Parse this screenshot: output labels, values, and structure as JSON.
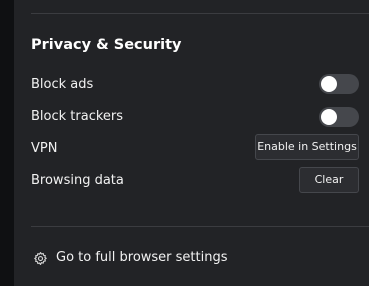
{
  "section": {
    "title": "Privacy & Security"
  },
  "settings": {
    "block_ads": {
      "label": "Block ads",
      "enabled": false
    },
    "block_trackers": {
      "label": "Block trackers",
      "enabled": false
    },
    "vpn": {
      "label": "VPN",
      "button_label": "Enable in Settings"
    },
    "browsing_data": {
      "label": "Browsing data",
      "button_label": "Clear"
    }
  },
  "footer": {
    "icon": "gear-icon",
    "link_label": "Go to full browser settings"
  },
  "colors": {
    "panel_background": "#222326",
    "outer_background": "#0f1012",
    "toggle_off": "#45474c",
    "button_background": "#2c2d31"
  }
}
